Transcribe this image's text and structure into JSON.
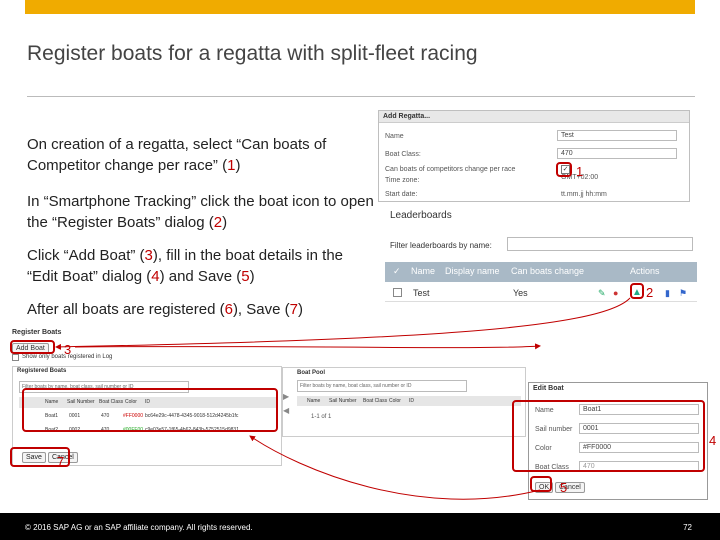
{
  "slide": {
    "title": "Register boats for a regatta with split-fleet racing",
    "bullets": [
      {
        "pre": "On creation of a regatta, select “Can boats of Competitor change per race” (",
        "n": "1",
        "post": ")"
      },
      {
        "pre": "In “Smartphone Tracking” click the boat icon to open the “Register Boats” dialog (",
        "n": "2",
        "post": ")"
      },
      {
        "pre": "Click “Add Boat” (",
        "n": "3",
        "mid": "), fill in the boat details in the “Edit Boat” dialog (",
        "n2": "4",
        "mid2": ") and Save (",
        "n3": "5",
        "post": ")"
      },
      {
        "pre": "After all boats are registered (",
        "n": "6",
        "mid": "), Save (",
        "n2": "7",
        "post": ")"
      }
    ],
    "footer_copy": "© 2016 SAP AG or an SAP affiliate company. All rights reserved.",
    "page": "72"
  },
  "add_regatta": {
    "title": "Add Regatta...",
    "name_label": "Name",
    "name_value": "Test",
    "boat_class_label": "Boat Class:",
    "boat_class_value": "470",
    "can_change_label": "Can boats of competitors change per race",
    "timezone_label": "Time zone:",
    "timezone_value": "GMT+02:00",
    "start_label": "Start date:",
    "start_value": "tt.mm.jj hh:mm"
  },
  "leaderboards": {
    "title": "Leaderboards",
    "filter_label": "Filter leaderboards by name:",
    "columns": [
      "✓",
      "Name",
      "Display name",
      "Can boats change",
      "Actions"
    ],
    "row": {
      "name": "Test",
      "can_change": "Yes"
    }
  },
  "register": {
    "title": "Register Boats",
    "add_boat": "Add Boat",
    "show_only": "Show only boats registered in Log",
    "registered_title": "Registered Boats",
    "pool_title": "Boat Pool",
    "filter_reg": "Filter boats by name, boat class, sail number or ID",
    "filter_pool": "Filter boats by name, boat class, sail number or ID",
    "reg_columns": [
      "Name",
      "Sail Number",
      "Boat Class",
      "Color",
      "ID"
    ],
    "pool_columns": [
      "Name",
      "Sail Number",
      "Boat Class",
      "Color",
      "ID"
    ],
    "rows": [
      {
        "name": "Boat1",
        "sail": "0001",
        "cls": "470",
        "color": "#FF0000",
        "id": "bc64e29c-4478-4345-9018-512d4245b1fc"
      },
      {
        "name": "Boat2",
        "sail": "0002",
        "cls": "470",
        "color": "#00FF00",
        "id": "c9e03e57-1f65-4b62-843b-5752515d9831"
      }
    ],
    "pager": "1-1 of 1",
    "save": "Save",
    "cancel": "Cancel"
  },
  "edit_boat": {
    "title": "Edit Boat",
    "name_label": "Name",
    "name_value": "Boat1",
    "sail_label": "Sail number",
    "sail_value": "0001",
    "color_label": "Color",
    "color_value": "#FF0000",
    "class_label": "Boat Class",
    "class_value": "470",
    "ok": "OK",
    "cancel": "Cancel"
  },
  "markers": [
    "1",
    "2",
    "3",
    "4",
    "5",
    "6",
    "7"
  ]
}
